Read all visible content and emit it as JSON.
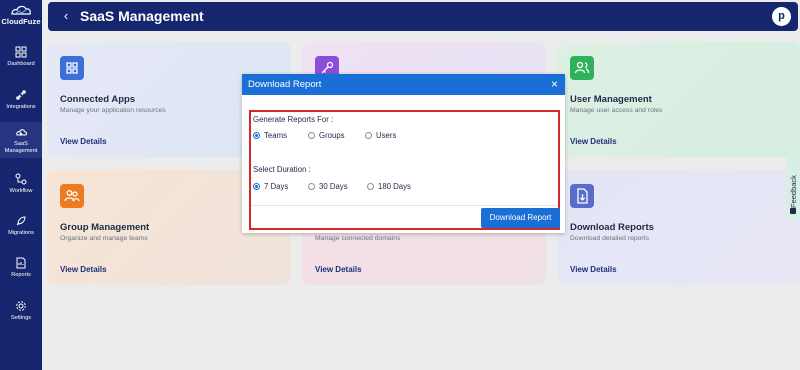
{
  "app": {
    "logo_text": "CloudFuze"
  },
  "sidebar": {
    "items": [
      {
        "label": "Dashboard",
        "icon": "grid-icon"
      },
      {
        "label": "Integrations",
        "icon": "plug-icon"
      },
      {
        "label": "SaaS Management",
        "icon": "cloud-gear-icon",
        "active": true
      },
      {
        "label": "Workflow",
        "icon": "workflow-icon"
      },
      {
        "label": "Migrations",
        "icon": "rocket-icon"
      },
      {
        "label": "Reports",
        "icon": "report-icon"
      },
      {
        "label": "Settings",
        "icon": "gear-icon"
      }
    ]
  },
  "header": {
    "title": "SaaS Management",
    "avatar_letter": "p"
  },
  "cards": [
    {
      "title": "Connected Apps",
      "description": "Manage your application resources",
      "link": "View Details",
      "icon": "apps-grid-icon",
      "color": "#3b6fd6"
    },
    {
      "title": "",
      "description": "",
      "link": "",
      "icon": "key-icon",
      "color": "#8a4fd8"
    },
    {
      "title": "User Management",
      "description": "Manage user access and roles",
      "link": "View Details",
      "icon": "users-icon",
      "color": "#2eb35b"
    },
    {
      "title": "Group Management",
      "description": "Organize and manage teams",
      "link": "View Details",
      "icon": "group-icon",
      "color": "#ee7a22"
    },
    {
      "title": "",
      "description": "Manage connected domains",
      "link": "View Details",
      "icon": "",
      "color": ""
    },
    {
      "title": "Download Reports",
      "description": "Download detailed reports",
      "link": "View Details",
      "icon": "download-icon",
      "color": "#5a6cc9"
    }
  ],
  "feedback": {
    "label": "Feedback"
  },
  "modal": {
    "title": "Download Report",
    "close": "×",
    "generate_label": "Generate Reports For :",
    "report_options": [
      {
        "label": "Teams",
        "selected": true
      },
      {
        "label": "Groups",
        "selected": false
      },
      {
        "label": "Users",
        "selected": false
      }
    ],
    "duration_label": "Select Duration :",
    "duration_options": [
      {
        "label": "7 Days",
        "selected": true
      },
      {
        "label": "30 Days",
        "selected": false
      },
      {
        "label": "180 Days",
        "selected": false
      }
    ],
    "submit_label": "Download Report"
  },
  "colors": {
    "sidebar": "#16266e",
    "accent": "#1a6fd6",
    "highlight": "#d22a2a"
  }
}
